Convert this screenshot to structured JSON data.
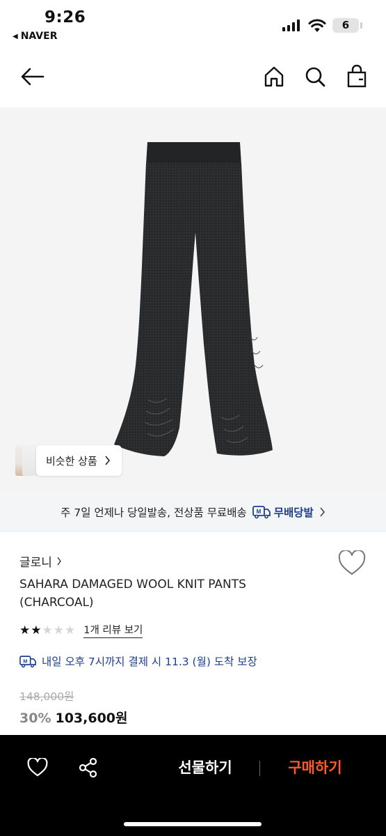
{
  "status_bar": {
    "time": "9:26",
    "back_app": "NAVER",
    "battery": "6"
  },
  "header": {
    "icons": [
      "back-arrow-icon",
      "home-icon",
      "search-icon",
      "shopping-bag-icon"
    ]
  },
  "hero": {
    "similar_label": "비슷한 상품"
  },
  "shipping_banner": {
    "text": "주 7일 언제나 당일발송, 전상품 무료배송",
    "badge_label": "무배당발"
  },
  "product": {
    "brand": "글로니",
    "title": "SAHARA DAMAGED WOOL KNIT PANTS (CHARCOAL)",
    "rating": 2,
    "rating_max": 5,
    "review_link": "1개 리뷰 보기",
    "delivery_text": "내일 오후 7시까지 결제 시 11.3 (월) 도착 보장",
    "original_price": "148,000원",
    "discount": "30%",
    "price": "103,600원"
  },
  "bottom_bar": {
    "gift_label": "선물하기",
    "buy_label": "구매하기"
  },
  "colors": {
    "accent_buy": "#ff5a1f",
    "delivery_blue": "#1d3f8f",
    "bar_bg": "#000000"
  }
}
